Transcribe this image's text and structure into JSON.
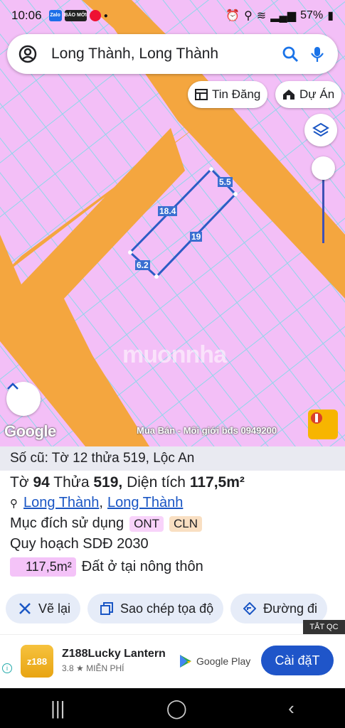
{
  "status": {
    "time": "10:06",
    "battery": "57%",
    "apps": [
      "Zalo",
      "BÁO MỚI"
    ]
  },
  "search": {
    "query": "Long Thành, Long Thành"
  },
  "chips": {
    "tin_dang": "Tin Đăng",
    "du_an": "Dự Án"
  },
  "parcel_labels": {
    "top": "5.5",
    "left": "18.4",
    "right": "19",
    "bottom": "6.2"
  },
  "map": {
    "google": "Google",
    "attribution": "Mua Bán - Môi giới bđs  0949200",
    "watermark": "muonnha",
    "colors": {
      "land": "#f3bff7",
      "road": "#f4a63f",
      "lot_line": "#8fd6ea",
      "parcel": "#2c5cc5"
    }
  },
  "info": {
    "old_ref": "Số cũ: Tờ 12 thửa 519, Lộc An",
    "sheet_label": "Tờ",
    "sheet": "94",
    "plot_label": "Thửa",
    "plot": "519,",
    "area_label": "Diện tích",
    "area": "117,5m²",
    "location": {
      "district": "Long Thành",
      "sep": ",",
      "commune": "Long Thành"
    },
    "purpose_label": "Mục đích sử dụng",
    "tags": [
      "ONT",
      "CLN"
    ],
    "plan_label": "Quy hoạch SDĐ 2030",
    "plan_area": "117,5m²",
    "plan_desc": "Đất ở tại nông thôn"
  },
  "actions": {
    "draw": "Vẽ lại",
    "copy": "Sao chép tọa độ",
    "directions": "Đường đi"
  },
  "ad": {
    "tag": "TẮT QC",
    "app_name": "Z188Lucky Lantern",
    "logo_text": "z188",
    "rating": "3.8",
    "price": "MIỄN PHÍ",
    "store": "Google Play",
    "install": "Cài đặT"
  }
}
